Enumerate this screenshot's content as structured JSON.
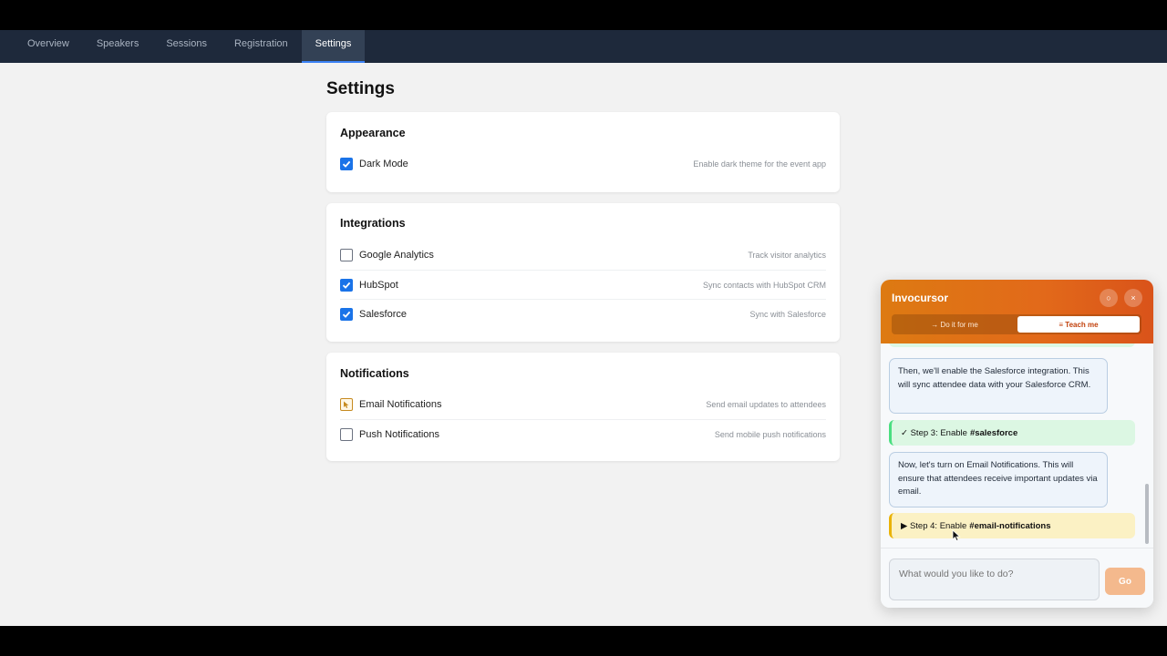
{
  "nav": {
    "tabs": [
      {
        "label": "Overview"
      },
      {
        "label": "Speakers"
      },
      {
        "label": "Sessions"
      },
      {
        "label": "Registration"
      },
      {
        "label": "Settings",
        "active": true
      }
    ]
  },
  "page": {
    "title": "Settings"
  },
  "sections": {
    "appearance": {
      "title": "Appearance",
      "items": [
        {
          "label": "Dark Mode",
          "desc": "Enable dark theme for the event app",
          "checked": true
        }
      ]
    },
    "integrations": {
      "title": "Integrations",
      "items": [
        {
          "label": "Google Analytics",
          "desc": "Track visitor analytics",
          "checked": false
        },
        {
          "label": "HubSpot",
          "desc": "Sync contacts with HubSpot CRM",
          "checked": true
        },
        {
          "label": "Salesforce",
          "desc": "Sync with Salesforce",
          "checked": true
        }
      ]
    },
    "notifications": {
      "title": "Notifications",
      "items": [
        {
          "label": "Email Notifications",
          "desc": "Send email updates to attendees",
          "checked": false
        },
        {
          "label": "Push Notifications",
          "desc": "Send mobile push notifications",
          "checked": false
        }
      ]
    }
  },
  "assistant": {
    "title": "Invocursor",
    "minimize_glyph": "○",
    "close_glyph": "×",
    "modes": {
      "do_it": "→ Do it for me",
      "teach_me": "≡ Teach me"
    },
    "messages": {
      "m1": "Then, we'll enable the Salesforce integration. This will sync attendee data with your Salesforce CRM.",
      "step3_prefix": "✓ Step 3: Enable",
      "step3_target": "#salesforce",
      "m2": "Now, let's turn on Email Notifications. This will ensure that attendees receive important updates via email.",
      "step4_prefix": "▶ Step 4: Enable",
      "step4_target": "#email-notifications"
    },
    "input_placeholder": "What would you like to do?",
    "go_label": "Go"
  },
  "colors": {
    "nav_bg": "#1e293b",
    "accent": "#1a73e8",
    "brand_orange": "#e2691a"
  }
}
